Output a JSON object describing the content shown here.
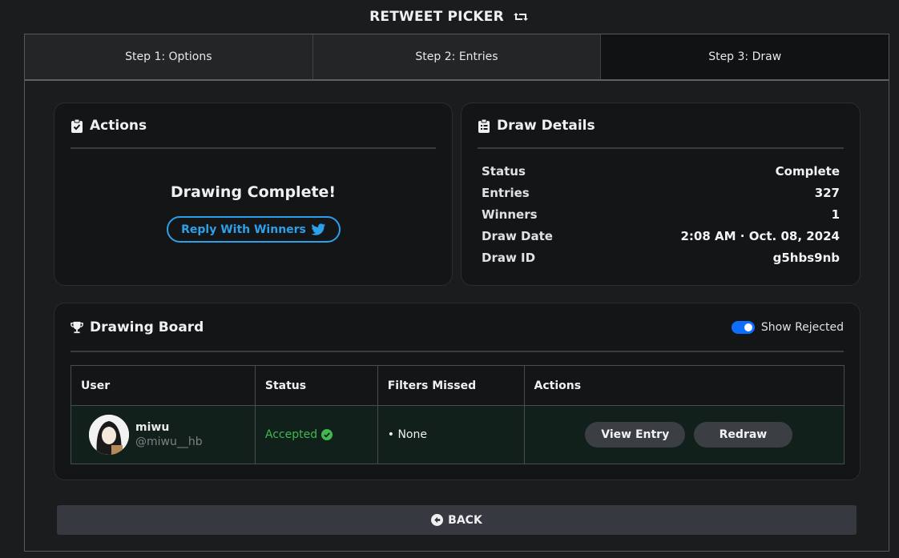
{
  "app": {
    "title": "RETWEET PICKER",
    "icon": "retweet-icon"
  },
  "steps": [
    {
      "label": "Step 1: Options",
      "active": false
    },
    {
      "label": "Step 2: Entries",
      "active": false
    },
    {
      "label": "Step 3: Draw",
      "active": true
    }
  ],
  "actions": {
    "title": "Actions",
    "icon": "clipboard-check-icon",
    "status_text": "Drawing Complete!",
    "reply_label": "Reply With Winners",
    "reply_icon": "twitter-bird-icon",
    "accent": "#2ea0ea"
  },
  "draw_details": {
    "title": "Draw Details",
    "icon": "clipboard-list-icon",
    "rows": [
      {
        "label": "Status",
        "value": "Complete"
      },
      {
        "label": "Entries",
        "value": "327"
      },
      {
        "label": "Winners",
        "value": "1"
      },
      {
        "label": "Draw Date",
        "value": "2:08 AM · Oct. 08, 2024"
      },
      {
        "label": "Draw ID",
        "value": "g5hbs9nb"
      }
    ]
  },
  "board": {
    "title": "Drawing Board",
    "icon": "trophy-icon",
    "show_rejected_label": "Show Rejected",
    "show_rejected_on": true,
    "columns": [
      "User",
      "Status",
      "Filters Missed",
      "Actions"
    ],
    "rows": [
      {
        "name": "miwu",
        "handle": "@miwu__hb",
        "status": "Accepted",
        "status_color": "#3fb950",
        "filters_missed": "• None",
        "view_label": "View Entry",
        "redraw_label": "Redraw"
      }
    ]
  },
  "back": {
    "label": "BACK",
    "icon": "arrow-circle-left-icon"
  }
}
